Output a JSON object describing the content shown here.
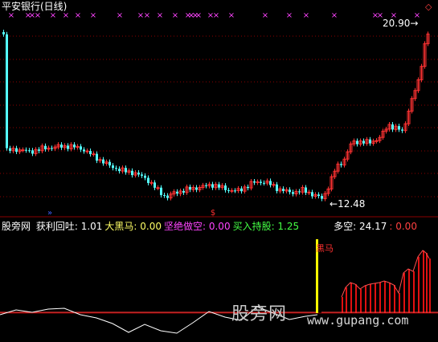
{
  "window": {
    "title": "平安银行(日线)",
    "corner_icon": "diamond-outline-icon"
  },
  "price_chart": {
    "high_label": "20.90",
    "low_label": "12.48",
    "arrow_glyph_left": "←",
    "marker_glyph": "×",
    "dollar_marker": "$",
    "double_arrow_marker": "»"
  },
  "indicator_bar": {
    "name": "股旁网",
    "items": [
      {
        "label": "获利回吐:",
        "value": "1.01",
        "color": "#ffffff"
      },
      {
        "label": "大黑马:",
        "value": "0.00",
        "color": "#ffff66"
      },
      {
        "label": "坚绝做空:",
        "value": "0.00",
        "color": "#ff44ff"
      },
      {
        "label": "买入持股:",
        "value": "1.25",
        "color": "#44ff44"
      },
      {
        "label": "多空:",
        "value": "24.17",
        "color": "#ffffff"
      },
      {
        "label": ":",
        "value": "0.00",
        "color": "#ff4040"
      }
    ]
  },
  "indicator_chart": {
    "heima_label": "黑马"
  },
  "watermark": {
    "cn": "股旁网",
    "url": "www.gupang.com"
  },
  "colors": {
    "up": "#ff3232",
    "down": "#54ffff",
    "grid": "#8b0000",
    "magenta": "#ff44ff",
    "yellow": "#ffff00"
  }
}
